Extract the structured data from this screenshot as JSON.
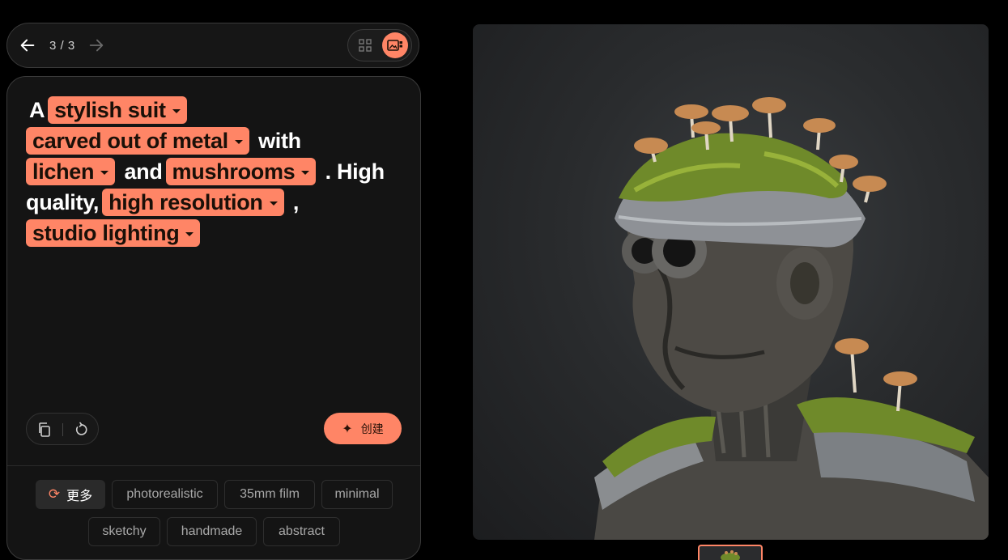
{
  "nav": {
    "counter": "3 / 3",
    "back_icon": "arrow-left-icon",
    "forward_icon": "arrow-right-icon",
    "grid_view_icon": "grid-icon",
    "single_view_icon": "image-view-icon"
  },
  "prompt": {
    "w1": "A",
    "chip1": "stylish suit",
    "chip2": "carved out of metal",
    "w2": "with",
    "chip3": "lichen",
    "w3": "and",
    "chip4": "mushrooms",
    "w4": ". High quality,",
    "chip5": "high resolution",
    "w5": ",",
    "chip6": "studio lighting"
  },
  "actions": {
    "create_label": "创建",
    "copy_icon": "copy-icon",
    "reset_icon": "refresh-icon"
  },
  "tags": {
    "more_label": "更多",
    "items": [
      "photorealistic",
      "35mm film",
      "minimal",
      "sketchy",
      "handmade",
      "abstract"
    ]
  },
  "colors": {
    "accent": "#ff8566",
    "panel_bg": "#141414",
    "page_bg": "#000000"
  }
}
